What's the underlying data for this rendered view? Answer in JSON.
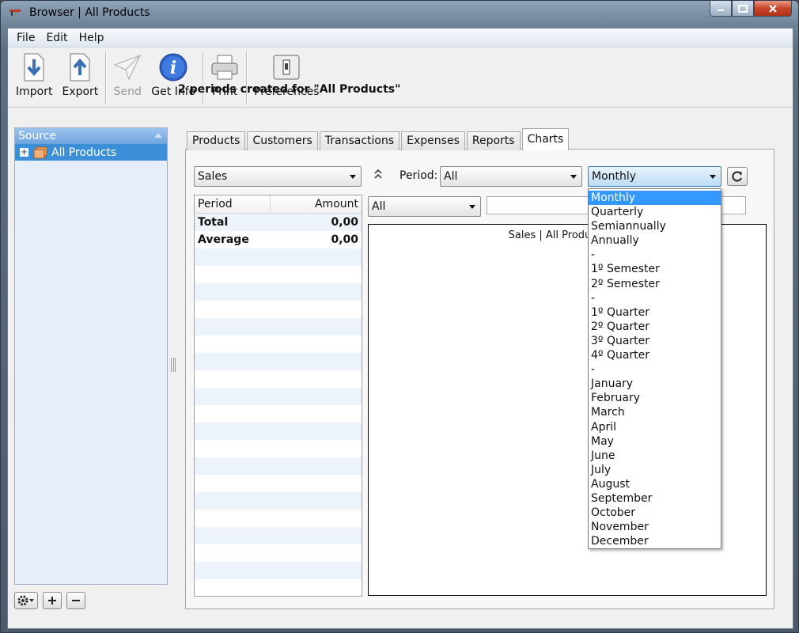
{
  "window": {
    "title": "Browser | All Products"
  },
  "menu": [
    "File",
    "Edit",
    "Help"
  ],
  "toolbar": {
    "import": "Import",
    "export": "Export",
    "send": "Send",
    "get_info": "Get Info",
    "print": "Print",
    "preferences": "Preferences"
  },
  "status": "2 periods created for \"All Products\"",
  "source": {
    "header": "Source",
    "item": "All Products"
  },
  "tabs": [
    "Products",
    "Customers",
    "Transactions",
    "Expenses",
    "Reports",
    "Charts"
  ],
  "controls": {
    "measure": "Sales",
    "period_label": "Period:",
    "period_value": "All",
    "grouping_value": "Monthly",
    "filter_value": "All"
  },
  "table": {
    "col_period": "Period",
    "col_amount": "Amount",
    "rows": [
      {
        "period": "Total",
        "amount": "0,00"
      },
      {
        "period": "Average",
        "amount": "0,00"
      }
    ]
  },
  "chart": {
    "title": "Sales | All Products | ..."
  },
  "dropdown_options": [
    "Monthly",
    "Quarterly",
    "Semiannually",
    "Annually",
    "-",
    "1º Semester",
    "2º Semester",
    "-",
    "1º Quarter",
    "2º Quarter",
    "3º Quarter",
    "4º Quarter",
    "-",
    "January",
    "February",
    "March",
    "April",
    "May",
    "June",
    "July",
    "August",
    "September",
    "October",
    "November",
    "December"
  ],
  "colors": {
    "selection": "#3399ff",
    "source_header": "#6ea6de",
    "source_selected": "#3b8fd8"
  }
}
